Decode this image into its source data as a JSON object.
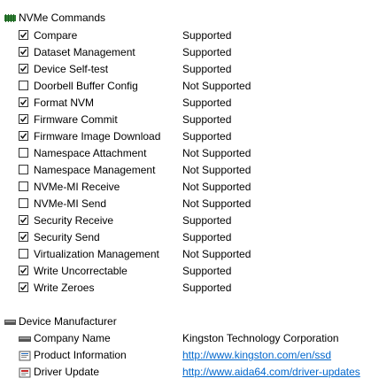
{
  "nvme": {
    "title": "NVMe Commands",
    "commands": [
      {
        "name": "Compare",
        "status": "Supported",
        "checked": true
      },
      {
        "name": "Dataset Management",
        "status": "Supported",
        "checked": true
      },
      {
        "name": "Device Self-test",
        "status": "Supported",
        "checked": true
      },
      {
        "name": "Doorbell Buffer Config",
        "status": "Not Supported",
        "checked": false
      },
      {
        "name": "Format NVM",
        "status": "Supported",
        "checked": true
      },
      {
        "name": "Firmware Commit",
        "status": "Supported",
        "checked": true
      },
      {
        "name": "Firmware Image Download",
        "status": "Supported",
        "checked": true
      },
      {
        "name": "Namespace Attachment",
        "status": "Not Supported",
        "checked": false
      },
      {
        "name": "Namespace Management",
        "status": "Not Supported",
        "checked": false
      },
      {
        "name": "NVMe-MI Receive",
        "status": "Not Supported",
        "checked": false
      },
      {
        "name": "NVMe-MI Send",
        "status": "Not Supported",
        "checked": false
      },
      {
        "name": "Security Receive",
        "status": "Supported",
        "checked": true
      },
      {
        "name": "Security Send",
        "status": "Supported",
        "checked": true
      },
      {
        "name": "Virtualization Management",
        "status": "Not Supported",
        "checked": false
      },
      {
        "name": "Write Uncorrectable",
        "status": "Supported",
        "checked": true
      },
      {
        "name": "Write Zeroes",
        "status": "Supported",
        "checked": true
      }
    ]
  },
  "manufacturer": {
    "title": "Device Manufacturer",
    "company_label": "Company Name",
    "company_value": "Kingston Technology Corporation",
    "product_label": "Product Information",
    "product_value": "http://www.kingston.com/en/ssd",
    "driver_label": "Driver Update",
    "driver_value": "http://www.aida64.com/driver-updates"
  },
  "colors": {
    "link": "#0066cc",
    "chip_icon": "#2e7d32",
    "device_icon": "#555555"
  },
  "icons": {
    "nvme_section": "chip-icon",
    "manufacturer_section": "device-icon",
    "company": "device-icon",
    "product": "info-icon",
    "driver": "driver-icon"
  }
}
